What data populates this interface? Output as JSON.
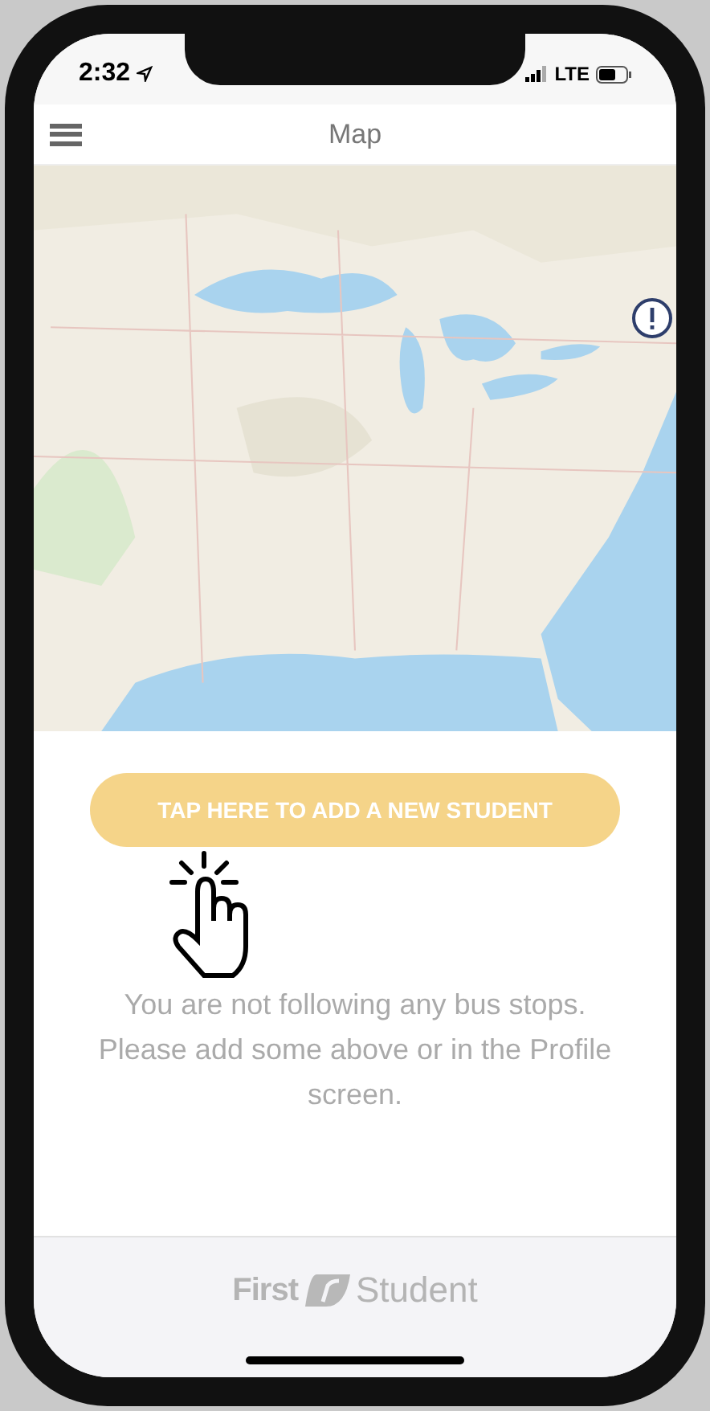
{
  "status_bar": {
    "time": "2:32",
    "network": "LTE"
  },
  "header": {
    "title": "Map"
  },
  "add_student_button": {
    "label": "TAP HERE TO ADD A NEW STUDENT"
  },
  "message": "You are not following any bus stops. Please add some above or in the Profile screen.",
  "footer": {
    "brand_first": "First",
    "brand_second": "Student"
  }
}
